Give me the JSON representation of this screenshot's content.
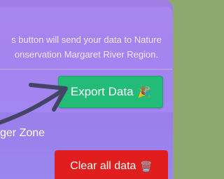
{
  "export": {
    "description_line1": "s button will send your data to Nature",
    "description_line2": "onservation Margaret River Region.",
    "button_label": "Export Data",
    "button_emoji": "🎉"
  },
  "danger": {
    "title": "ger Zone",
    "clear_label": "Clear all data",
    "clear_emoji": "🗑️"
  },
  "colors": {
    "panel": "#9d7fe8",
    "export_button": "#22bb77",
    "clear_button": "#e01e1e",
    "background": "#8fa86f",
    "annotation_arrow": "#444466"
  },
  "icons": {
    "annotation": "pointer-arrow-icon"
  }
}
